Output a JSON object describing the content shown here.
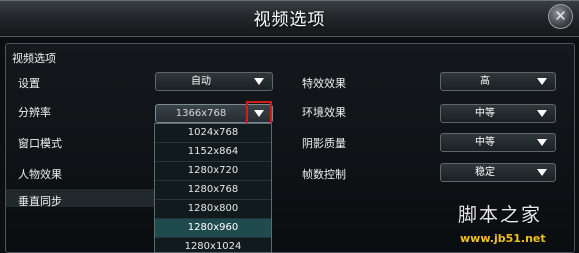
{
  "window": {
    "title": "视频选项",
    "close_icon": "close-icon"
  },
  "section": {
    "title": "视频选项"
  },
  "left": [
    {
      "label": "设置",
      "value": "自动"
    },
    {
      "label": "分辨率",
      "value": "1366x768"
    },
    {
      "label": "窗口模式"
    },
    {
      "label": "人物效果"
    },
    {
      "label": "垂直同步"
    }
  ],
  "right": [
    {
      "label": "特效效果",
      "value": "高"
    },
    {
      "label": "环境效果",
      "value": "中等"
    },
    {
      "label": "阴影质量",
      "value": "中等"
    },
    {
      "label": "帧数控制",
      "value": "稳定"
    }
  ],
  "resolution_dropdown": {
    "options": [
      "1024x768",
      "1152x864",
      "1280x720",
      "1280x768",
      "1280x800",
      "1280x960",
      "1280x1024"
    ],
    "selected": "1280x960"
  },
  "watermark": {
    "logo_text": "脚本之家",
    "url": "www.jb51.net"
  },
  "colors": {
    "highlight": "#d21c1c",
    "selected_row": "#1f4b4f"
  }
}
